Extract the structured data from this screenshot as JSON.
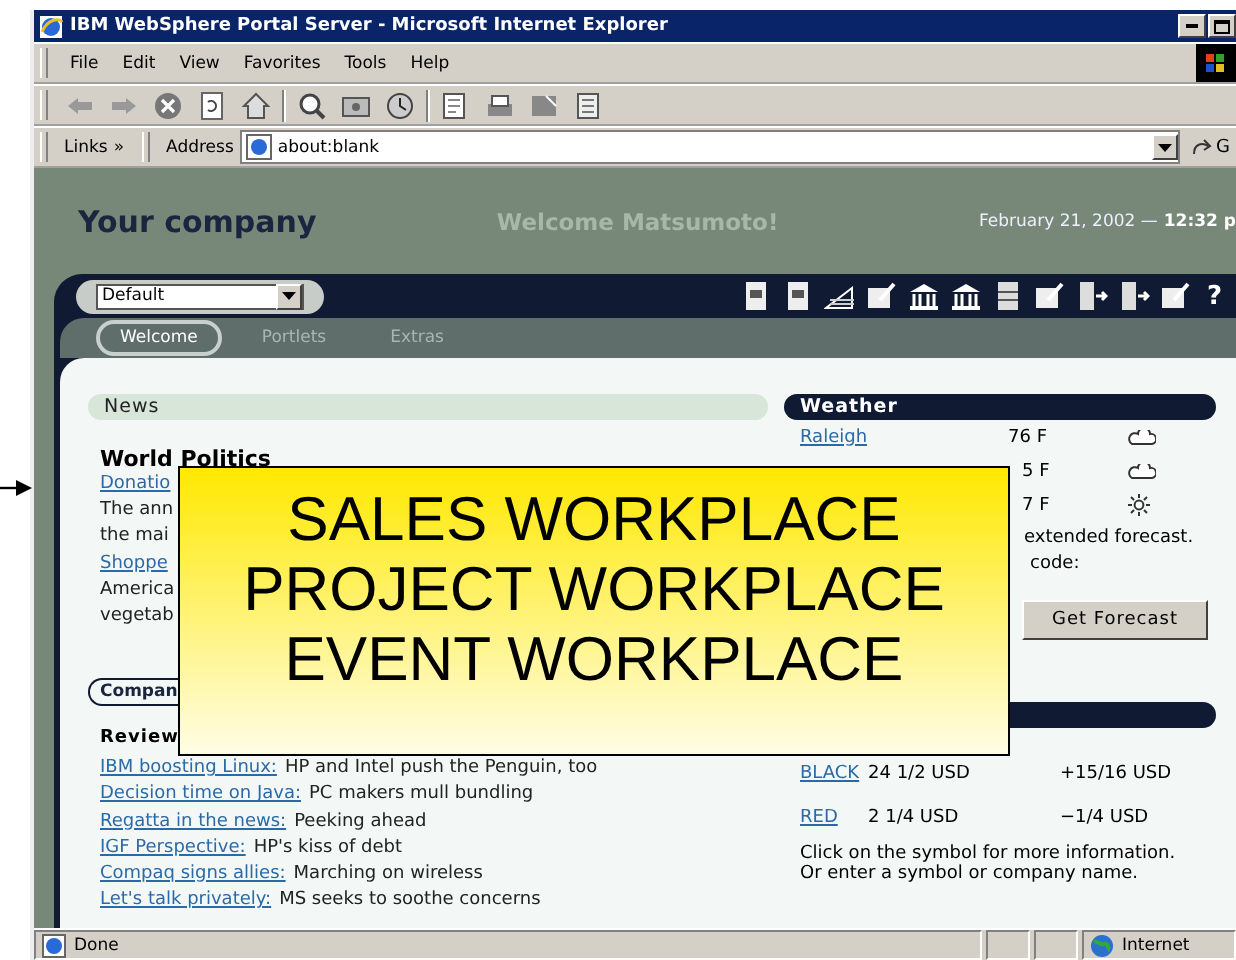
{
  "window": {
    "title": "IBM WebSphere Portal Server - Microsoft Internet Explorer"
  },
  "menu": [
    "File",
    "Edit",
    "View",
    "Favorites",
    "Tools",
    "Help"
  ],
  "address_bar": {
    "links_label": "Links",
    "links_more": "»",
    "address_label": "Address",
    "value": "about:blank",
    "go_label": "G"
  },
  "header": {
    "company": "Your company",
    "welcome": "Welcome Matsumoto!",
    "date": "February 21, 2002 —",
    "time": "12:32 p"
  },
  "page_select": {
    "value": "Default"
  },
  "help_label": "?",
  "tabs": [
    {
      "label": "Welcome",
      "selected": true
    },
    {
      "label": "Portlets",
      "selected": false
    },
    {
      "label": "Extras",
      "selected": false
    }
  ],
  "news": {
    "title": "News",
    "headline": "World Politics",
    "lines": [
      {
        "kind": "link",
        "text": "Donatio"
      },
      {
        "kind": "text",
        "text": "The ann"
      },
      {
        "kind": "text",
        "text": "the mai"
      },
      {
        "kind": "link",
        "text": "Shoppe"
      },
      {
        "kind": "text",
        "text": "America"
      },
      {
        "kind": "text",
        "text": "vegetab"
      }
    ]
  },
  "company_news": {
    "title": "Compan",
    "subtitle": "Review",
    "items": [
      {
        "link": "IBM boosting Linux:",
        "text": "HP and Intel push the Penguin, too"
      },
      {
        "link": "Decision time on Java:",
        "text": "PC makers mull bundling"
      },
      {
        "link": "Regatta in the news:",
        "text": "Peeking ahead"
      },
      {
        "link": "IGF Perspective:",
        "text": "HP's kiss of debt"
      },
      {
        "link": "Compaq signs allies:",
        "text": "Marching on wireless"
      },
      {
        "link": "Let's talk privately:",
        "text": "MS seeks to soothe concerns"
      }
    ]
  },
  "weather": {
    "title": "Weather",
    "rows": [
      {
        "city": "Raleigh",
        "temp": "76 F",
        "kind": "cloudy"
      },
      {
        "temp": "5 F",
        "kind": "cloudy"
      },
      {
        "temp": "7 F",
        "kind": "sunny"
      }
    ],
    "notes": [
      "extended forecast.",
      "code:"
    ],
    "button": "Get Forecast"
  },
  "stocks": {
    "rows": [
      {
        "symbol": "BLACK",
        "price": "24 1/2 USD",
        "change": "+15/16 USD"
      },
      {
        "symbol": "RED",
        "price": "2 1/4 USD",
        "change": "−1/4 USD"
      }
    ],
    "notes": [
      "Click on the symbol for more information.",
      "Or enter a symbol or company name."
    ]
  },
  "callout": {
    "lines": [
      "SALES WORKPLACE",
      "PROJECT WORKPLACE",
      "EVENT WORKPLACE"
    ]
  },
  "status_bar": {
    "text": "Done",
    "zone": "Internet"
  }
}
